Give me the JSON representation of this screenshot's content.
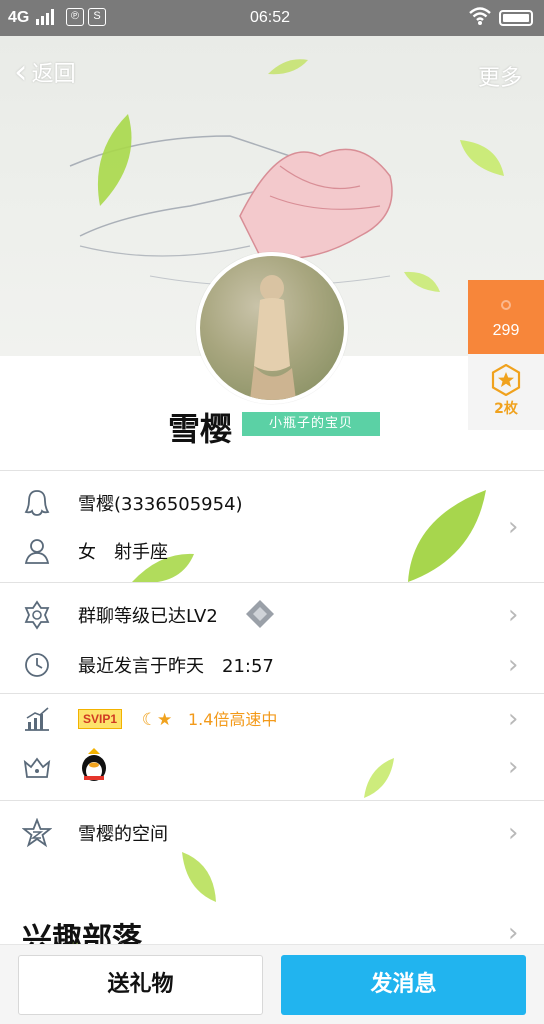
{
  "status_bar": {
    "network": "4G",
    "time": "06:52",
    "icon_hd": "℗",
    "icon_s": "S"
  },
  "header": {
    "back_label": "返回",
    "more_label": "更多"
  },
  "side": {
    "score": "299",
    "medal_count": "2枚"
  },
  "profile": {
    "name": "雪樱",
    "nickname_badge": "小瓶子的宝贝"
  },
  "rows": {
    "qq": "雪樱(3336505954)",
    "gender_sign": "女　射手座",
    "group_level": "群聊等级已达LV2",
    "last_speak": "最近发言于昨天　21:57",
    "svip_badge": "SVIP1",
    "svip_speed": "1.4倍高速中",
    "space": "雪樱的空间"
  },
  "interest_title": "兴趣部落",
  "bottom": {
    "gift_label": "送礼物",
    "message_label": "发消息"
  },
  "colors": {
    "accent_blue": "#21b4ef",
    "score_orange": "#f7863a",
    "badge_green": "#5bd1a5"
  }
}
